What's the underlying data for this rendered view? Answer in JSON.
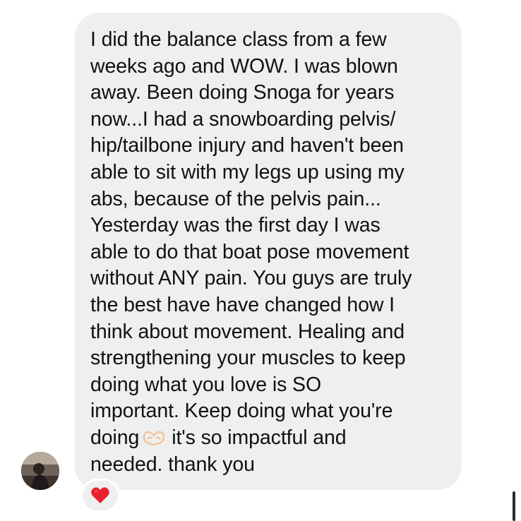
{
  "message": {
    "lines": [
      "I did the balance class from a few",
      "weeks ago and WOW. I was blown",
      "away. Been doing Snoga for years",
      "now...I had a snowboarding pelvis/",
      "hip/tailbone injury and haven't been",
      "able to sit with my legs up using my",
      "abs, because of the pelvis pain...",
      "Yesterday was the first day I was",
      "able to do that boat pose movement",
      "without ANY pain. You guys are truly",
      "the best have have changed how I",
      "think about movement. Healing and",
      "strengthening your muscles to keep",
      "doing what you love is SO",
      "important. Keep doing what you're"
    ],
    "line_before_emoji": "doing",
    "line_after_emoji": "it's so impactful and",
    "last_line": "needed. thank you",
    "emoji_icon": "heart-hands-icon"
  },
  "reaction": {
    "icon": "red-heart-icon",
    "color": "#e8202c"
  },
  "colors": {
    "bubble": "#efefef",
    "text": "#111111",
    "background": "#ffffff"
  }
}
